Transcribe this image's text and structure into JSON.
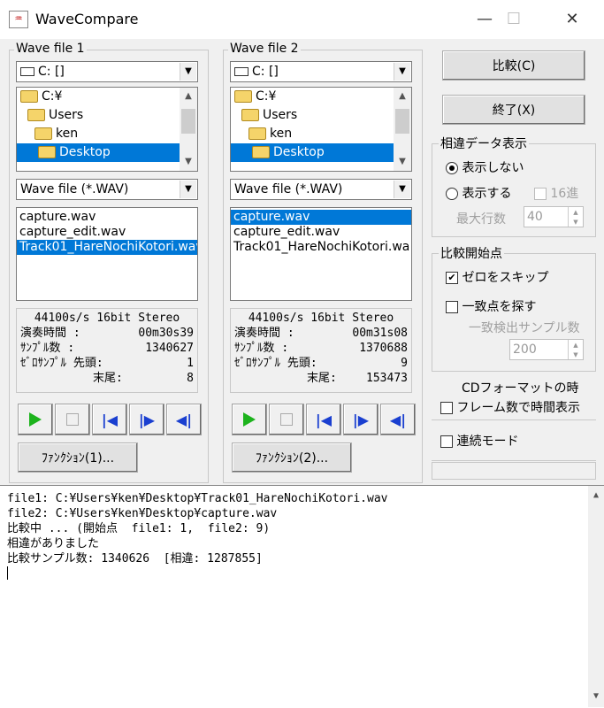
{
  "window": {
    "title": "WaveCompare"
  },
  "panel1": {
    "group_label": "Wave file 1",
    "drive": "C: []",
    "folders": [
      "C:¥",
      "Users",
      "ken",
      "Desktop"
    ],
    "file_type": "Wave file (*.WAV)",
    "files": [
      "capture.wav",
      "capture_edit.wav",
      "Track01_HareNochiKotori.wav"
    ],
    "info": {
      "format": "44100s/s 16bit Stereo",
      "play_label": "演奏時間 :",
      "play_value": "00m30s39",
      "samples_label": "ｻﾝﾌﾟﾙ数  :",
      "samples_value": "1340627",
      "zero_label": "ｾﾞﾛｻﾝﾌﾟﾙ 先頭:",
      "zero_head": "1",
      "tail_label": "末尾:",
      "zero_tail": "8"
    },
    "function_label": "ﾌｧﾝｸｼｮﾝ(1)..."
  },
  "panel2": {
    "group_label": "Wave file 2",
    "drive": "C: []",
    "folders": [
      "C:¥",
      "Users",
      "ken",
      "Desktop"
    ],
    "file_type": "Wave file (*.WAV)",
    "files": [
      "capture.wav",
      "capture_edit.wav",
      "Track01_HareNochiKotori.wa"
    ],
    "info": {
      "format": "44100s/s 16bit Stereo",
      "play_label": "演奏時間 :",
      "play_value": "00m31s08",
      "samples_label": "ｻﾝﾌﾟﾙ数  :",
      "samples_value": "1370688",
      "zero_label": "ｾﾞﾛｻﾝﾌﾟﾙ 先頭:",
      "zero_head": "9",
      "tail_label": "末尾:",
      "zero_tail": "153473"
    },
    "function_label": "ﾌｧﾝｸｼｮﾝ(2)..."
  },
  "right": {
    "compare_label": "比較(C)",
    "exit_label": "終了(X)",
    "diff_group": "相違データ表示",
    "no_show": "表示しない",
    "show": "表示する",
    "hex": "16進",
    "max_rows_label": "最大行数",
    "max_rows_value": "40",
    "start_group": "比較開始点",
    "skip_zero": "ゼロをスキップ",
    "find_match": "一致点を探す",
    "match_samples_label": "一致検出サンプル数",
    "match_samples_value": "200",
    "cd_label": "CDフォーマットの時",
    "frames_label": "フレーム数で時間表示",
    "continuous_label": "連続モード"
  },
  "log": {
    "lines": [
      "file1: C:¥Users¥ken¥Desktop¥Track01_HareNochiKotori.wav",
      "file2: C:¥Users¥ken¥Desktop¥capture.wav",
      "比較中 ... (開始点  file1: 1,  file2: 9)",
      "相違がありました",
      "比較サンプル数: 1340626  [相違: 1287855]"
    ]
  }
}
